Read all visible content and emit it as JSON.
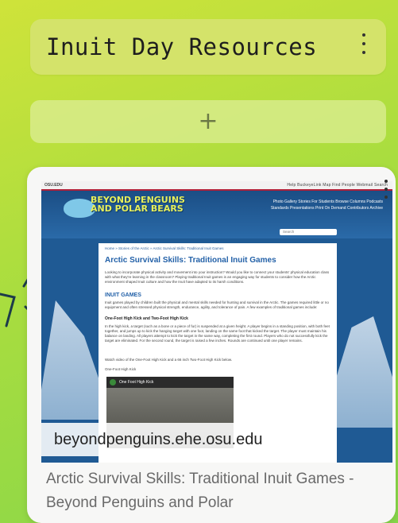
{
  "column": {
    "title": "Inuit Day Resources"
  },
  "add_button": {
    "label": "+"
  },
  "card": {
    "link_chip": "beyondpenguins.ehe.osu.edu",
    "title": "Arctic Survival Skills: Traditional Inuit Games - Beyond Penguins and Polar",
    "preview": {
      "site_label": "OSU.EDU",
      "top_links": "Help  BuckeyeLink  Map  Find People  Webmail  Search",
      "logo_line1": "BEYOND PENGUINS",
      "logo_line2": "AND POLAR BEARS",
      "nav_line1": "Photo Gallery   Stories For Students   Browse Columns   Podcasts",
      "nav_line2": "Standards   Presentations   Print On Demand   Contributors   Archive",
      "search_placeholder": "Search",
      "breadcrumb": "Home » Stories of the Arctic » Arctic Survival Skills: Traditional Inuit Games",
      "heading": "Arctic Survival Skills: Traditional Inuit Games",
      "intro": "Looking to incorporate physical activity and movement into your instruction? Would you like to connect your students' physical education class with what they're learning in the classroom? Playing traditional Inuit games is an engaging way for students to consider how the Arctic environment shaped Inuit culture and how the Inuit have adapted to its harsh conditions.",
      "section_heading": "INUIT GAMES",
      "section_text": "Inuit games played by children built the physical and mental skills needed for hunting and survival in the Arctic. The games required little or no equipment and often stressed physical strength, endurance, agility, and tolerance of pain. A few examples of traditional games include:",
      "sub_heading": "One-Foot High Kick and Two-Foot High Kick",
      "kick_text": "In the high kick, a target (such as a bone or a piece of fur) is suspended at a given height. A player begins in a standing position, with both feet together, and jumps up to kick the hanging target with one foot, landing on the same foot that kicked the target. The player must maintain his balance on landing. All players attempt to kick the target in the same way, completing the first round. Players who do not successfully kick the target are eliminated. For the second round, the target is raised a few inches. Rounds are continued until one player remains.",
      "watch_text": "Watch video of the One-Foot High Kick and a 66 inch Two-Foot High Kick below.",
      "video_caption": "One-Foot High Kick",
      "video_title": "One Foot High Kick"
    }
  }
}
